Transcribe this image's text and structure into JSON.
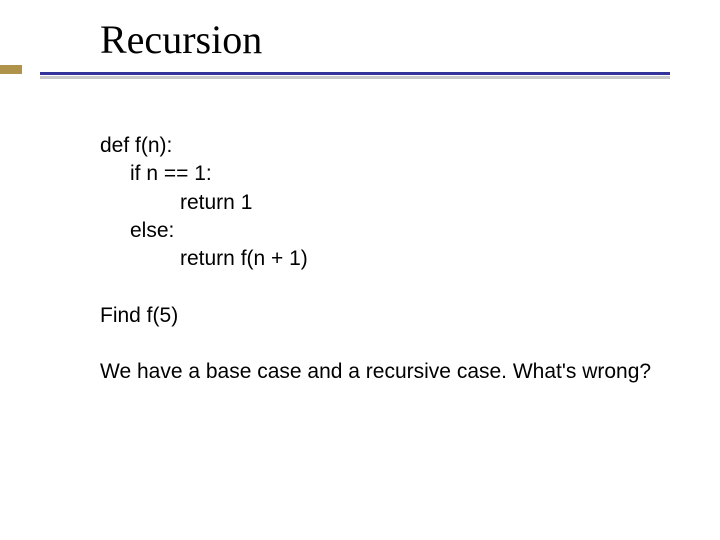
{
  "title": "Recursion",
  "code": {
    "l1": "def f(n):",
    "l2": "if n == 1:",
    "l3": "return 1",
    "l4": "else:",
    "l5": "return f(n + 1)"
  },
  "find_line": "Find f(5)",
  "question": "We have a base case and a recursive case.  What's wrong?"
}
